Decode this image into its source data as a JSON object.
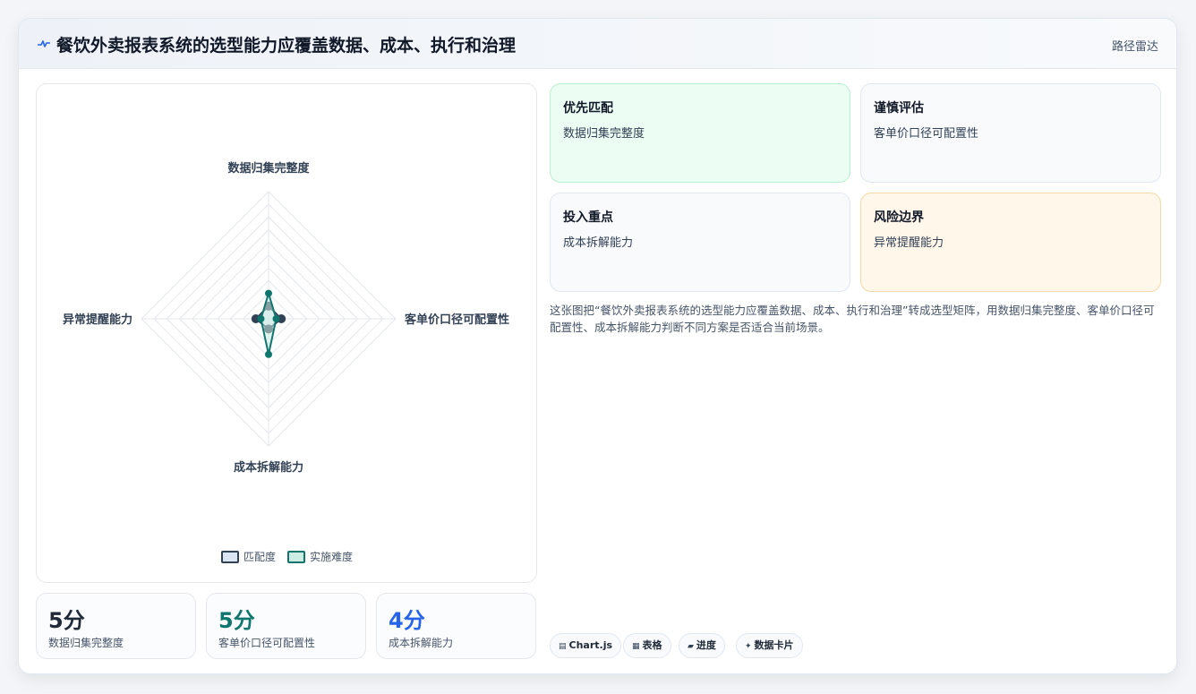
{
  "header": {
    "title": "餐饮外卖报表系统的选型能力应覆盖数据、成本、执行和治理",
    "right_label": "路径雷达",
    "icon": "pulse-icon"
  },
  "chart_data": {
    "type": "radar",
    "axes": [
      "数据归集完整度",
      "客单价口径可配置性",
      "成本拆解能力",
      "异常提醒能力"
    ],
    "series": [
      {
        "name": "匹配度",
        "values": [
          5,
          5,
          4,
          5
        ],
        "color": "#334155",
        "fill": "#dbe4f3"
      },
      {
        "name": "实施难度",
        "values": [
          10,
          3,
          14,
          3
        ],
        "color": "#0f766e",
        "fill": "#ccece4"
      }
    ],
    "rlim": [
      0,
      50
    ],
    "ticks": 10,
    "legend_position": "bottom"
  },
  "stats": [
    {
      "value": "5分",
      "label": "数据归集完整度",
      "color": "#1f2937"
    },
    {
      "value": "5分",
      "label": "客单价口径可配置性",
      "color": "#0f766e"
    },
    {
      "value": "4分",
      "label": "成本拆解能力",
      "color": "#2563eb"
    }
  ],
  "tiles": [
    {
      "title": "优先匹配",
      "value": "数据归集完整度"
    },
    {
      "title": "谨慎评估",
      "value": "客单价口径可配置性"
    },
    {
      "title": "投入重点",
      "value": "成本拆解能力"
    },
    {
      "title": "风险边界",
      "value": "异常提醒能力"
    }
  ],
  "description": "这张图把“餐饮外卖报表系统的选型能力应覆盖数据、成本、执行和治理”转成选型矩阵，用数据归集完整度、客单价口径可配置性、成本拆解能力判断不同方案是否适合当前场景。",
  "chips": [
    {
      "icon": "▤",
      "label": "Chart.js"
    },
    {
      "icon": "▦",
      "label": "表格"
    },
    {
      "icon": "▰",
      "label": "进度"
    },
    {
      "icon": "✦",
      "label": "数据卡片"
    }
  ]
}
